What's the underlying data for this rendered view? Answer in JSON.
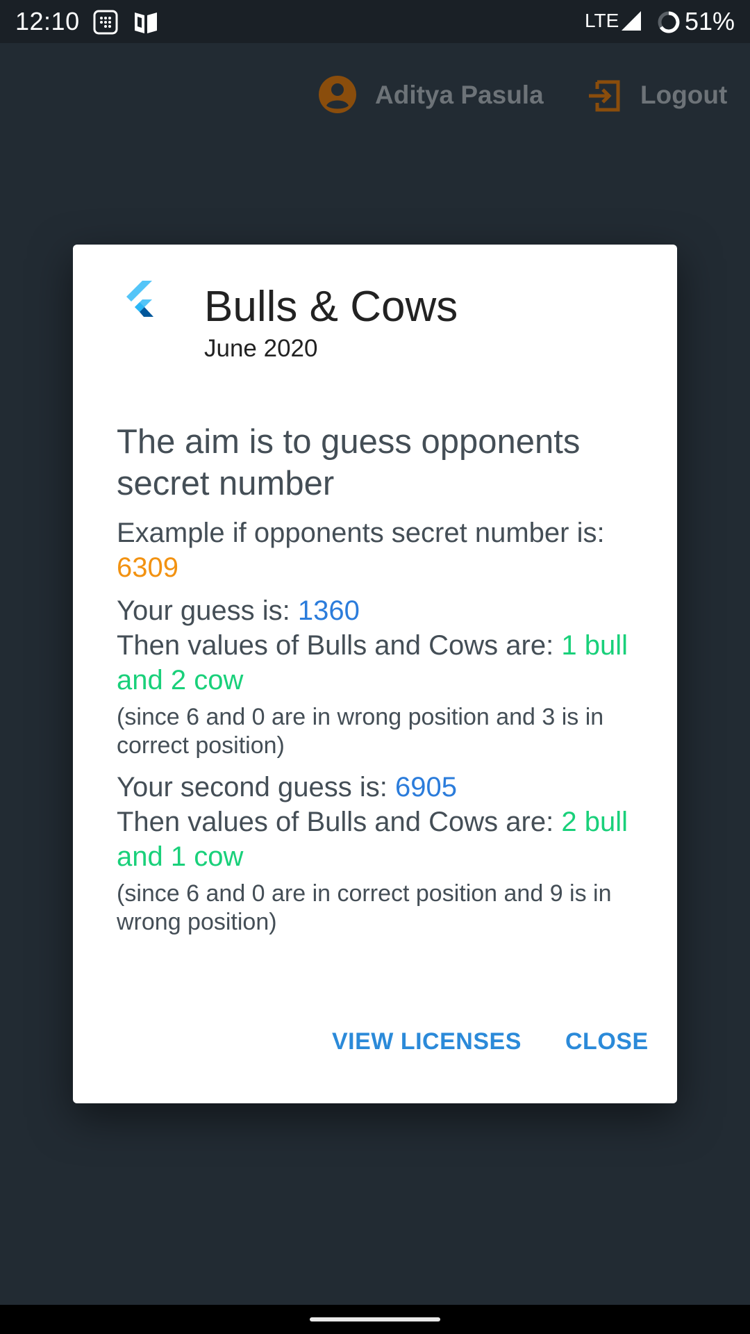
{
  "status_bar": {
    "time": "12:10",
    "network": "LTE",
    "battery": "51%",
    "icons": [
      "app-grid-icon",
      "shield-book-icon",
      "signal-icon",
      "battery-ring-icon"
    ]
  },
  "app_bar": {
    "user_name": "Aditya Pasula",
    "logout_label": "Logout",
    "accent_color": "#8a4d0c"
  },
  "dialog": {
    "title": "Bulls & Cows",
    "version": "June 2020",
    "aim": "The aim is to guess opponents secret number",
    "example_prefix": "Example if opponents secret number is:",
    "secret_number": "6309",
    "guess1_prefix": "Your guess is:",
    "guess1_value": "1360",
    "result1_prefix": "Then values of Bulls and Cows are:",
    "result1_value": "1 bull and 2 cow",
    "note1": "(since 6 and 0 are in wrong position and 3 is in correct position)",
    "guess2_prefix": "Your second guess is:",
    "guess2_value": "6905",
    "result2_prefix": "Then values of Bulls and Cows are:",
    "result2_value": "2 bull and 1 cow",
    "note2": "(since 6 and 0 are in correct position and 9 is in wrong position)",
    "view_licenses_label": "VIEW LICENSES",
    "close_label": "CLOSE"
  },
  "colors": {
    "secret": "#f29211",
    "guess": "#2b7cdb",
    "result": "#19d07a",
    "button": "#2b8ad9"
  }
}
